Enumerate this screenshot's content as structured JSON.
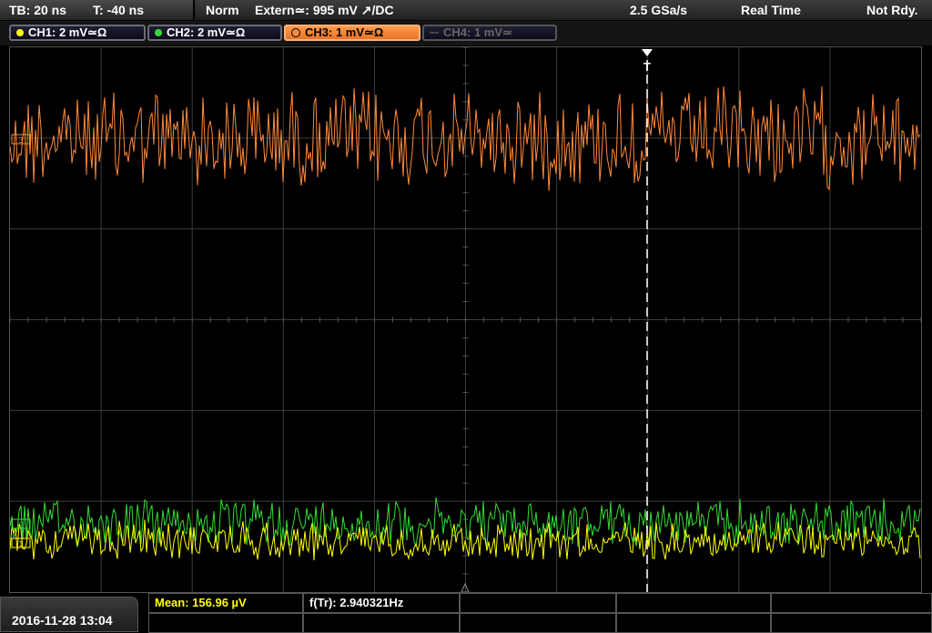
{
  "topbar": {
    "timebase": "TB: 20 ns",
    "trigger_time": "T: -40 ns",
    "mode": "Norm",
    "trigger_source": "Extern≃: 995 mV ↗/DC",
    "sample_rate": "2.5 GSa/s",
    "acq_mode": "Real Time",
    "status": "Not Rdy."
  },
  "channels": [
    {
      "label": "CH1: 2 mV≃Ω",
      "color": "#ffff00",
      "active": true
    },
    {
      "label": "CH2: 2 mV≃Ω",
      "color": "#33dd33",
      "active": true
    },
    {
      "label": "CH3: 1 mV≃Ω",
      "color": "#ff8a3a",
      "active": true,
      "selected": true
    },
    {
      "label": "CH4: 1 mV≃",
      "color": "#666666",
      "active": false
    }
  ],
  "trigger_marker": "T",
  "ref_labels": {
    "ch3": "3",
    "ch2": "2",
    "ch1": "1"
  },
  "footer": {
    "datetime": "2016-11-28 13:04",
    "mean": "Mean: 156.96 µV",
    "freq": "f(Tr): 2.940321Hz"
  },
  "colors": {
    "ch1": "#ffff00",
    "ch2": "#33dd33",
    "ch3": "#ff8a3a",
    "grid": "#3c3c3c"
  }
}
